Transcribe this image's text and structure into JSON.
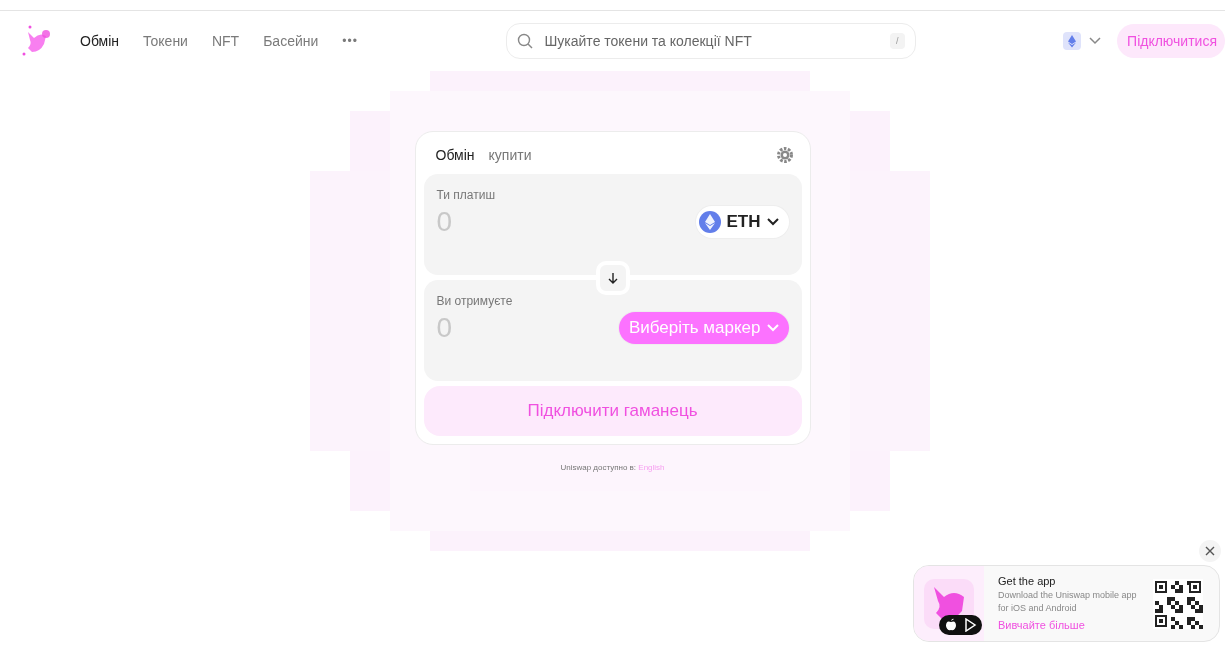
{
  "nav": {
    "items": [
      {
        "label": "Обмін",
        "selected": true
      },
      {
        "label": "Токени",
        "selected": false
      },
      {
        "label": "NFT",
        "selected": false
      },
      {
        "label": "Басейни",
        "selected": false
      }
    ],
    "more": "•••"
  },
  "search": {
    "placeholder": "Шукайте токени та колекції NFT",
    "shortcut": "/"
  },
  "connect_button": "Підключитися",
  "swap": {
    "tabs": [
      {
        "label": "Обмін",
        "selected": true
      },
      {
        "label": "купити",
        "selected": false
      }
    ],
    "panels": [
      {
        "label": "Ти платиш",
        "amount": "0",
        "token": {
          "kind": "token",
          "label": "ETH"
        }
      },
      {
        "label": "Ви отримуєте",
        "amount": "0",
        "token": {
          "kind": "select",
          "label": "Виберіть маркер"
        }
      }
    ],
    "action": "Підключити гаманець"
  },
  "footer": {
    "text": "Uniswap доступно в:",
    "link": "English"
  },
  "app_banner": {
    "title": "Get the app",
    "text": "Download the Uniswap mobile app for iOS and Android",
    "link": "Вивчайте більше"
  }
}
